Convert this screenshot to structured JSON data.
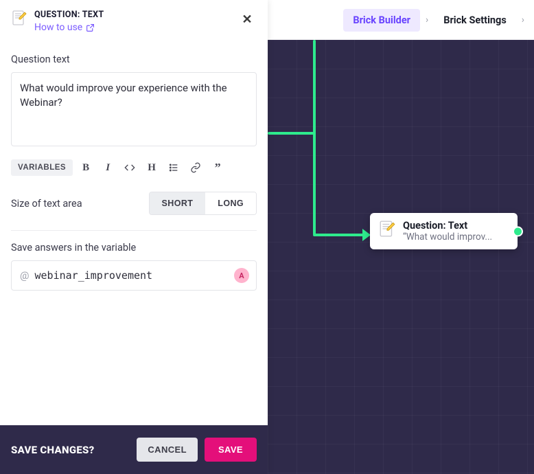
{
  "header": {
    "title": "QUESTION: TEXT",
    "link_label": "How to use"
  },
  "questionText": {
    "label": "Question text",
    "value": "What would improve your experience with the Webinar?"
  },
  "toolbar": {
    "variables_label": "VARIABLES"
  },
  "sizeArea": {
    "label": "Size of text area",
    "options": {
      "short": "SHORT",
      "long": "LONG"
    },
    "selected": "short"
  },
  "variable": {
    "label": "Save answers in the variable",
    "prefix": "@",
    "value": "webinar_improvement",
    "badge": "A"
  },
  "footer": {
    "title": "SAVE CHANGES?",
    "cancel": "CANCEL",
    "save": "SAVE"
  },
  "breadcrumbs": {
    "item1": "Brick Builder",
    "item2": "Brick Settings",
    "sep": "›"
  },
  "node": {
    "title": "Question: Text",
    "subtitle": "“What would improv..."
  },
  "colors": {
    "accent": "#7b5cff",
    "success": "#2eeb8d",
    "danger": "#e40f7a",
    "canvas": "#2f2a4a"
  }
}
